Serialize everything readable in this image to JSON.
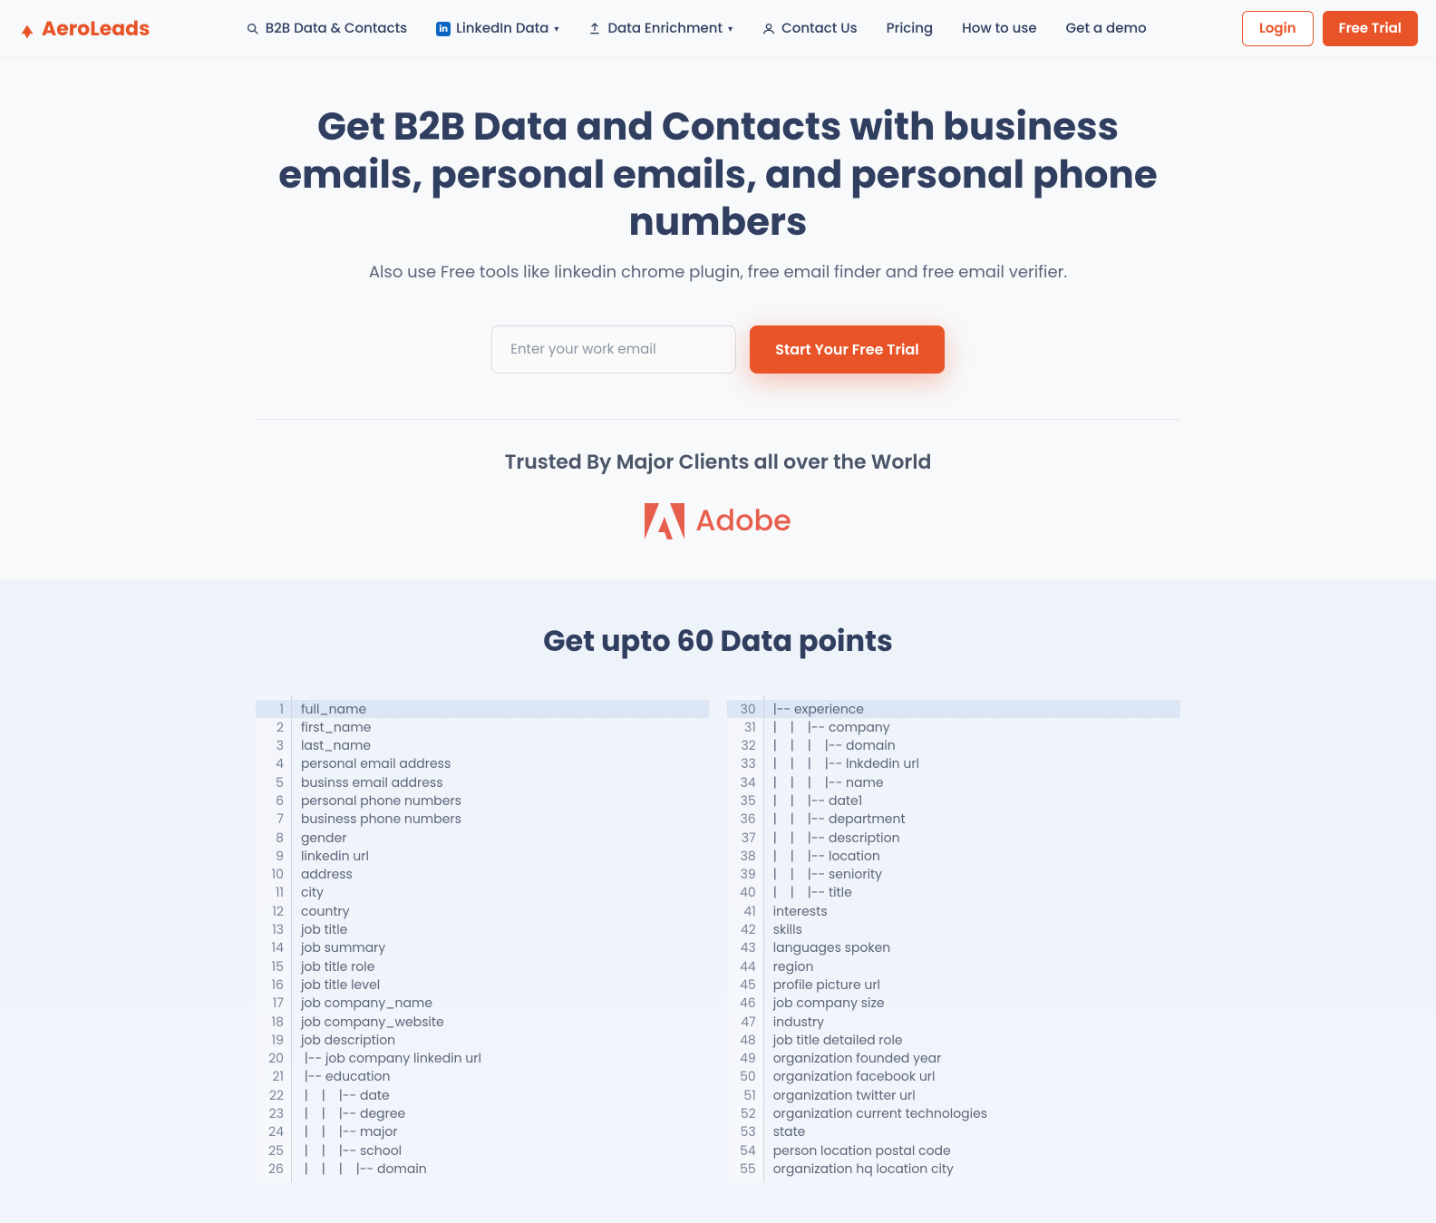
{
  "brand": "AeroLeads",
  "nav": {
    "items": [
      {
        "label": "B2B Data & Contacts",
        "icon": "search",
        "dropdown": false
      },
      {
        "label": "LinkedIn Data",
        "icon": "linkedin",
        "dropdown": true
      },
      {
        "label": "Data Enrichment",
        "icon": "upload",
        "dropdown": true
      },
      {
        "label": "Contact Us",
        "icon": "person",
        "dropdown": false
      },
      {
        "label": "Pricing",
        "icon": "",
        "dropdown": false
      },
      {
        "label": "How to use",
        "icon": "",
        "dropdown": false
      },
      {
        "label": "Get a demo",
        "icon": "",
        "dropdown": false
      }
    ],
    "login": "Login",
    "free_trial": "Free Trial"
  },
  "hero": {
    "title": "Get B2B Data and Contacts with business emails, personal emails, and personal phone numbers",
    "subtitle": "Also use Free tools like linkedin chrome plugin, free email finder and free email verifier.",
    "email_placeholder": "Enter your work email",
    "cta": "Start Your Free Trial",
    "trusted_title": "Trusted By Major Clients all over the World",
    "client": "Adobe"
  },
  "data_points": {
    "title": "Get upto 60 Data points",
    "left": [
      {
        "num": "1",
        "text": "full_name",
        "hl": true
      },
      {
        "num": "2",
        "text": "first_name"
      },
      {
        "num": "3",
        "text": "last_name"
      },
      {
        "num": "4",
        "text": "personal email address"
      },
      {
        "num": "5",
        "text": "businss email address"
      },
      {
        "num": "6",
        "text": "personal phone numbers"
      },
      {
        "num": "7",
        "text": "business phone numbers"
      },
      {
        "num": "8",
        "text": "gender"
      },
      {
        "num": "9",
        "text": "linkedin url"
      },
      {
        "num": "10",
        "text": "address"
      },
      {
        "num": "11",
        "text": "city"
      },
      {
        "num": "12",
        "text": "country"
      },
      {
        "num": "13",
        "text": "job title"
      },
      {
        "num": "14",
        "text": "job summary"
      },
      {
        "num": "15",
        "text": "job title role"
      },
      {
        "num": "16",
        "text": "job title level"
      },
      {
        "num": "17",
        "text": "job company_name"
      },
      {
        "num": "18",
        "text": "job company_website"
      },
      {
        "num": "19",
        "text": "job description"
      },
      {
        "num": "20",
        "text": " |-- job company linkedin url"
      },
      {
        "num": "21",
        "text": " |-- education"
      },
      {
        "num": "22",
        "text": " |    |    |-- date"
      },
      {
        "num": "23",
        "text": " |    |    |-- degree"
      },
      {
        "num": "24",
        "text": " |    |    |-- major"
      },
      {
        "num": "25",
        "text": " |    |    |-- school"
      },
      {
        "num": "26",
        "text": " |    |    |    |-- domain"
      }
    ],
    "right": [
      {
        "num": "30",
        "text": "|-- experience",
        "hl": true
      },
      {
        "num": "31",
        "text": "|    |    |-- company"
      },
      {
        "num": "32",
        "text": "|    |    |    |-- domain"
      },
      {
        "num": "33",
        "text": "|    |    |    |-- lnkdedin url"
      },
      {
        "num": "34",
        "text": "|    |    |    |-- name"
      },
      {
        "num": "35",
        "text": "|    |    |-- date1"
      },
      {
        "num": "36",
        "text": "|    |    |-- department"
      },
      {
        "num": "37",
        "text": "|    |    |-- description"
      },
      {
        "num": "38",
        "text": "|    |    |-- location"
      },
      {
        "num": "39",
        "text": "|    |    |-- seniority"
      },
      {
        "num": "40",
        "text": "|    |    |-- title"
      },
      {
        "num": "41",
        "text": "interests"
      },
      {
        "num": "42",
        "text": "skills"
      },
      {
        "num": "43",
        "text": "languages spoken"
      },
      {
        "num": "44",
        "text": "region"
      },
      {
        "num": "45",
        "text": "profile picture url"
      },
      {
        "num": "46",
        "text": "job company size"
      },
      {
        "num": "47",
        "text": "industry"
      },
      {
        "num": "48",
        "text": "job title detailed role"
      },
      {
        "num": "49",
        "text": "organization founded year"
      },
      {
        "num": "50",
        "text": "organization facebook url"
      },
      {
        "num": "51",
        "text": "organization twitter url"
      },
      {
        "num": "52",
        "text": "organization current technologies"
      },
      {
        "num": "53",
        "text": "state"
      },
      {
        "num": "54",
        "text": "person location postal code"
      },
      {
        "num": "55",
        "text": "organization hq location city"
      }
    ]
  }
}
